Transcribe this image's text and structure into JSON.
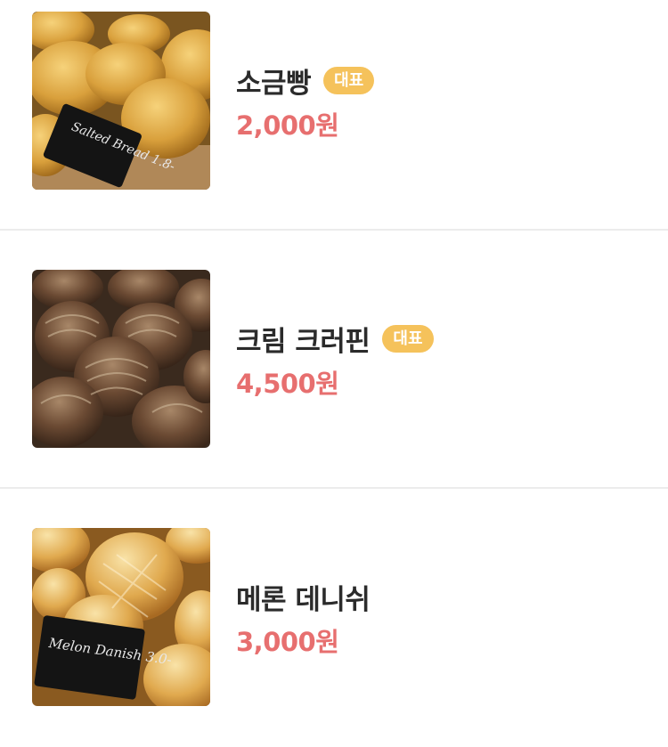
{
  "colors": {
    "badge_bg": "#f5c25b",
    "price": "#e76f6f",
    "name": "#2b2b2b",
    "divider": "#ececec"
  },
  "menu": {
    "items": [
      {
        "name": "소금빵",
        "badge": "대표",
        "price": "2,000원",
        "image": "salt-bread-photo",
        "sign_text": "Salted Bread 1.8-"
      },
      {
        "name": "크림 크러핀",
        "badge": "대표",
        "price": "4,500원",
        "image": "cream-cruffin-photo"
      },
      {
        "name": "메론 데니쉬",
        "price": "3,000원",
        "image": "melon-danish-photo",
        "sign_text": "Melon Danish 3.0-"
      }
    ]
  }
}
